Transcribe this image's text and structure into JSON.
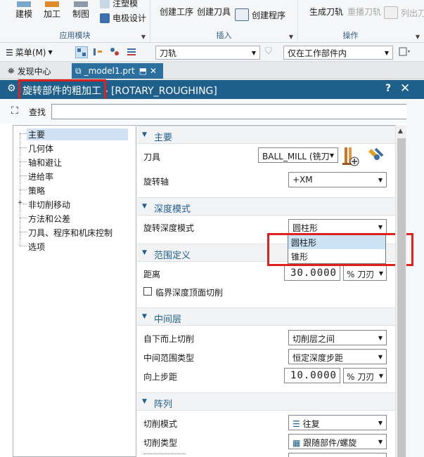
{
  "ribbon": {
    "groups": [
      {
        "title": "应用模块"
      },
      {
        "title": "插入"
      },
      {
        "title": "操作"
      }
    ],
    "buttons": {
      "build": "建模",
      "machining": "加工",
      "drafting": "制图",
      "annotation": "注塑模",
      "electrode": "电极设计",
      "create_operation": "创建工序",
      "create_tool": "创建刀具",
      "create_program": "创建程序",
      "generate_path": "生成刀轨",
      "replay_path": "重播刀轨",
      "list_path": "列出刀"
    }
  },
  "toolbar2": {
    "menu_label": "菜单(M)",
    "filter_combo": "刀轨",
    "scope_combo": "仅在工作部件内"
  },
  "tabs": {
    "discovery": "发现中心",
    "model": "_model1.prt"
  },
  "dialog": {
    "title_cn": "旋转部件的粗加工",
    "title_sep": " - [ROTARY_ROUGHING]",
    "help": "?",
    "close": "✕"
  },
  "search": {
    "label": "查找",
    "value": ""
  },
  "tree": {
    "items": [
      {
        "label": "主要",
        "selected": true
      },
      {
        "label": "几何体"
      },
      {
        "label": "轴和避让"
      },
      {
        "label": "进给率"
      },
      {
        "label": "策略"
      },
      {
        "label": "非切削移动",
        "expandable": true
      },
      {
        "label": "方法和公差"
      },
      {
        "label": "刀具、程序和机床控制"
      },
      {
        "label": "选项"
      }
    ]
  },
  "sections": {
    "main": {
      "title": "主要",
      "tool_label": "刀具",
      "tool_value": "BALL_MILL (铣刀",
      "axis_label": "旋转轴",
      "axis_value": "+XM"
    },
    "depth": {
      "title": "深度模式",
      "mode_label": "旋转深度模式",
      "mode_value": "圆柱形",
      "options": [
        "圆柱形",
        "锥形"
      ]
    },
    "range": {
      "title": "范围定义",
      "distance_label": "距离",
      "distance_value": "30.0000",
      "distance_unit": "% 刀刃",
      "critical_label": "临界深度顶面切削"
    },
    "mid": {
      "title": "中间层",
      "top_down_label": "自下而上切削",
      "top_down_value": "切削层之间",
      "range_type_label": "中间范围类型",
      "range_type_value": "恒定深度步距",
      "step_label": "向上步距",
      "step_value": "10.0000",
      "step_unit": "% 刀刃"
    },
    "pattern": {
      "title": "阵列",
      "cut_mode_label": "切削模式",
      "cut_mode_value": "往复",
      "cut_type_label": "切削类型",
      "cut_type_value": "跟随部件/螺旋"
    }
  },
  "colors": {
    "title_bar": "#1f5f8b",
    "highlight_red": "#e0201c",
    "selection": "#cfe3f5"
  }
}
